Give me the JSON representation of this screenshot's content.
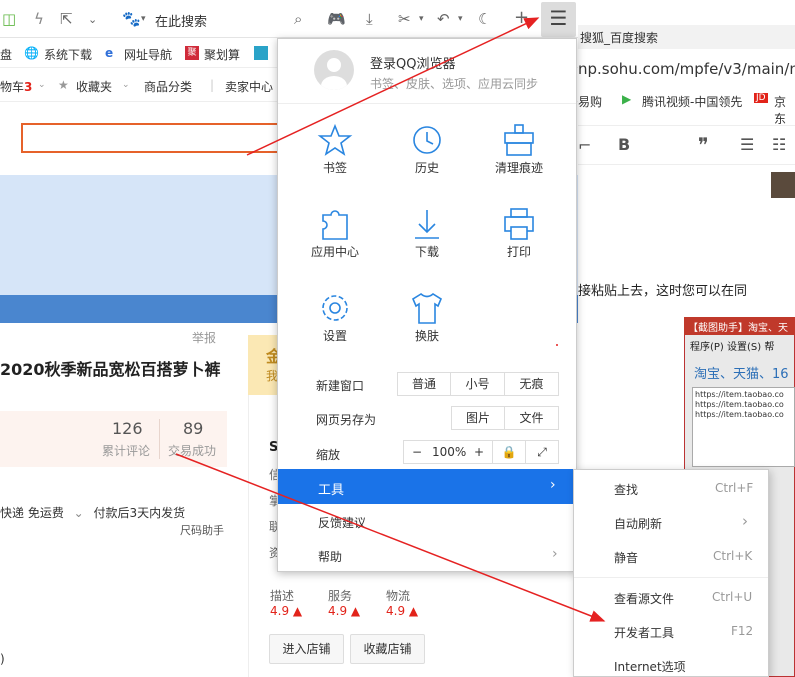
{
  "toolbar": {
    "search_placeholder": "在此搜索"
  },
  "bookmarks": {
    "items": [
      "盘",
      "系统下载",
      "网址导航",
      "聚划算"
    ]
  },
  "shop_bar": {
    "cart": "物车",
    "cart_count": "3",
    "favorites": "收藏夹",
    "categories": "商品分类",
    "seller": "卖家中心"
  },
  "left_page": {
    "report": "举报",
    "product_title": "2020秋季新品宽松百搭萝卜裤",
    "stats": [
      {
        "value": "126",
        "label": "累计评论"
      },
      {
        "value": "89",
        "label": "交易成功"
      }
    ],
    "shipping": "快递 免运费",
    "dispatch": "付款后3天内发货",
    "size_helper": "尺码助手",
    "paren": ")"
  },
  "store": {
    "gold_text": "金",
    "gold_sub": "我",
    "side_chars": [
      "S",
      "信",
      "掌",
      "联",
      "资"
    ],
    "ratings": [
      {
        "label": "描述",
        "value": "4.9"
      },
      {
        "label": "服务",
        "value": "4.9"
      },
      {
        "label": "物流",
        "value": "4.9"
      }
    ],
    "enter_btn": "进入店铺",
    "fav_btn": "收藏店铺"
  },
  "right_window": {
    "tab_title": "搜狐_百度搜索",
    "url": "np.sohu.com/mpfe/v3/main/new",
    "bookmarks": [
      "易购",
      "腾讯视频-中国领先",
      "京东"
    ],
    "paste_text": "接粘贴上去，这时您可以在同",
    "shot_title": "【截图助手】淘宝、天",
    "shot_menu": "程序(P)   设置(S)   帮",
    "shot_text": "淘宝、天猫、16",
    "shot_lines": [
      "https://item.taobao.co",
      "https://item.taobao.co",
      "https://item.taobao.co"
    ]
  },
  "main_menu": {
    "login_title": "登录QQ浏览器",
    "login_sub": "书签、皮肤、选项、应用云同步",
    "grid": [
      {
        "label": "书签",
        "icon": "star-icon"
      },
      {
        "label": "历史",
        "icon": "clock-icon"
      },
      {
        "label": "清理痕迹",
        "icon": "broom-icon"
      },
      {
        "label": "应用中心",
        "icon": "puzzle-icon"
      },
      {
        "label": "下载",
        "icon": "download-icon"
      },
      {
        "label": "打印",
        "icon": "printer-icon"
      },
      {
        "label": "设置",
        "icon": "gear-icon"
      },
      {
        "label": "换肤",
        "icon": "shirt-icon"
      }
    ],
    "new_window": {
      "label": "新建窗口",
      "options": [
        "普通",
        "小号",
        "无痕"
      ]
    },
    "save_as": {
      "label": "网页另存为",
      "options": [
        "图片",
        "文件"
      ]
    },
    "zoom": {
      "label": "缩放",
      "minus": "−",
      "value": "100%",
      "plus": "+"
    },
    "tools": "工具",
    "feedback": "反馈建议",
    "help": "帮助"
  },
  "submenu": {
    "items": [
      {
        "label": "查找",
        "shortcut": "Ctrl+F"
      },
      {
        "label": "自动刷新",
        "shortcut": "›"
      },
      {
        "label": "静音",
        "shortcut": "Ctrl+K"
      },
      {
        "label": "查看源文件",
        "shortcut": "Ctrl+U"
      },
      {
        "label": "开发者工具",
        "shortcut": "F12"
      },
      {
        "label": "Internet选项",
        "shortcut": ""
      }
    ]
  },
  "colors": {
    "accent": "#1a73e8",
    "annotation_arrow": "#e52222",
    "price_red": "#e2231a"
  }
}
